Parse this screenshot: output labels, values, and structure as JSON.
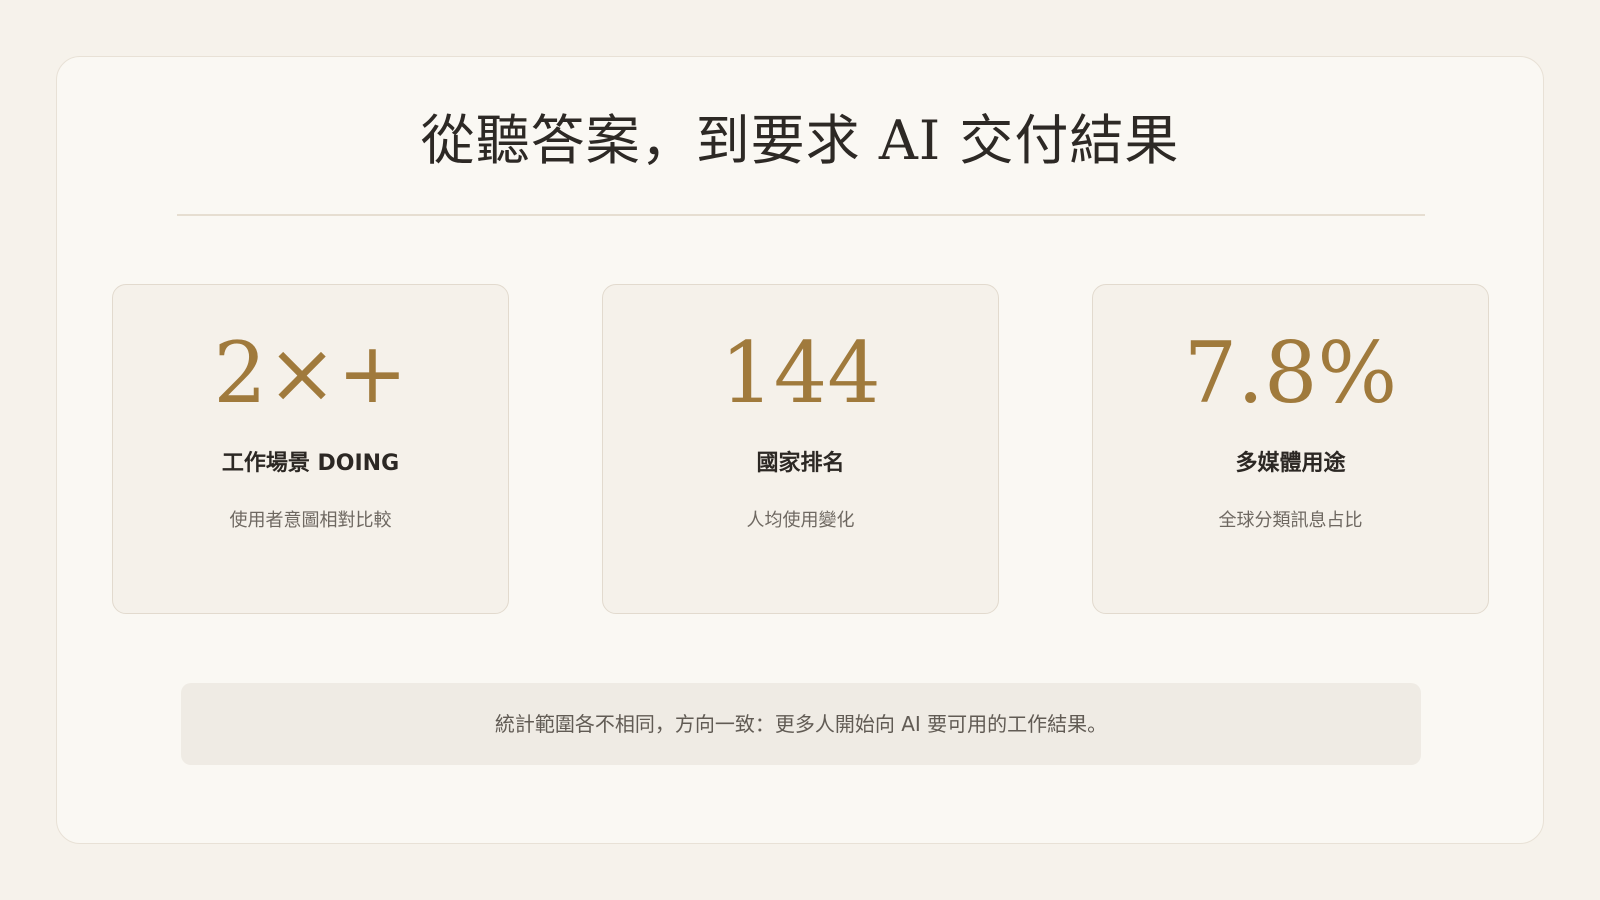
{
  "title": "從聽答案，到要求 AI 交付結果",
  "cards": [
    {
      "value": "2×+",
      "label": "工作場景 DOING",
      "description": "使用者意圖相對比較"
    },
    {
      "value": "144",
      "label": "國家排名",
      "description": "人均使用變化"
    },
    {
      "value": "7.8%",
      "label": "多媒體用途",
      "description": "全球分類訊息占比"
    }
  ],
  "footnote": "統計範圍各不相同，方向一致：更多人開始向 AI 要可用的工作結果。",
  "colors": {
    "background": "#f6f2eb",
    "panel": "#faf8f3",
    "card": "#f5f1ea",
    "accent": "#a07a3c",
    "text": "#2c2824",
    "muted": "#6e6861",
    "footnote_bg": "#efebe4"
  }
}
